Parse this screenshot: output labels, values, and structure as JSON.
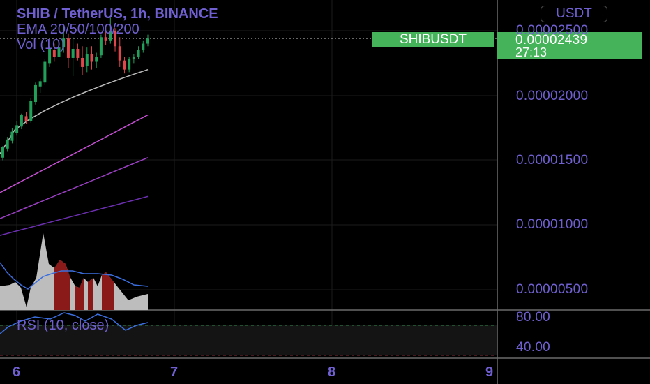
{
  "header": {
    "title": "SHIB / TetherUS, 1h, BINANCE",
    "ema_legend": "EMA 20/50/100/200",
    "vol_legend": "Vol (10)",
    "rsi_legend": "RSI (10, close)",
    "currency": "USDT"
  },
  "price_tag": {
    "symbol": "SHIBUSDT",
    "price": "0.00002439",
    "countdown": "27:13"
  },
  "axes": {
    "y_ticks": [
      "0.00002500",
      "0.00002000",
      "0.00001500",
      "0.00001000",
      "0.00000500"
    ],
    "rsi_ticks": [
      "80.00",
      "40.00"
    ],
    "x_ticks": [
      "6",
      "7",
      "8",
      "9"
    ]
  },
  "colors": {
    "up": "#22a05a",
    "down": "#e0464a",
    "accent": "#44b35a",
    "text": "#6f5fd0",
    "ema20": "#bdbdbd",
    "ema50": "#c64fd4",
    "ema100": "#9b3fc4",
    "ema200": "#6b2fb0",
    "vol_ma": "#3b6fe0"
  },
  "chart_data": {
    "type": "candlestick",
    "title": "SHIB / TetherUS, 1h, BINANCE",
    "x_ticks": [
      "6",
      "7",
      "8",
      "9"
    ],
    "ylim": [
      4.5e-06,
      2.66e-05
    ],
    "candles": [
      {
        "o": 1.52e-05,
        "h": 1.61e-05,
        "l": 1.5e-05,
        "c": 1.6e-05
      },
      {
        "o": 1.59e-05,
        "h": 1.68e-05,
        "l": 1.57e-05,
        "c": 1.66e-05
      },
      {
        "o": 1.65e-05,
        "h": 1.75e-05,
        "l": 1.63e-05,
        "c": 1.72e-05
      },
      {
        "o": 1.71e-05,
        "h": 1.8e-05,
        "l": 1.69e-05,
        "c": 1.77e-05
      },
      {
        "o": 1.76e-05,
        "h": 1.86e-05,
        "l": 1.74e-05,
        "c": 1.85e-05
      },
      {
        "o": 1.84e-05,
        "h": 1.87e-05,
        "l": 1.78e-05,
        "c": 1.8e-05
      },
      {
        "o": 1.8e-05,
        "h": 1.98e-05,
        "l": 1.79e-05,
        "c": 1.96e-05
      },
      {
        "o": 1.95e-05,
        "h": 2.1e-05,
        "l": 1.93e-05,
        "c": 2.08e-05
      },
      {
        "o": 2.07e-05,
        "h": 2.13e-05,
        "l": 2.02e-05,
        "c": 2.11e-05
      },
      {
        "o": 2.1e-05,
        "h": 2.28e-05,
        "l": 2.08e-05,
        "c": 2.26e-05
      },
      {
        "o": 2.25e-05,
        "h": 2.38e-05,
        "l": 2.22e-05,
        "c": 2.36e-05
      },
      {
        "o": 2.35e-05,
        "h": 2.4e-05,
        "l": 2.26e-05,
        "c": 2.3e-05
      },
      {
        "o": 2.3e-05,
        "h": 2.38e-05,
        "l": 2.28e-05,
        "c": 2.37e-05
      },
      {
        "o": 2.37e-05,
        "h": 2.53e-05,
        "l": 2.33e-05,
        "c": 2.44e-05
      },
      {
        "o": 2.44e-05,
        "h": 2.48e-05,
        "l": 2.21e-05,
        "c": 2.29e-05
      },
      {
        "o": 2.29e-05,
        "h": 2.45e-05,
        "l": 2.15e-05,
        "c": 2.36e-05
      },
      {
        "o": 2.36e-05,
        "h": 2.4e-05,
        "l": 2.27e-05,
        "c": 2.29e-05
      },
      {
        "o": 2.29e-05,
        "h": 2.38e-05,
        "l": 2.16e-05,
        "c": 2.22e-05
      },
      {
        "o": 2.23e-05,
        "h": 2.37e-05,
        "l": 2.18e-05,
        "c": 2.32e-05
      },
      {
        "o": 2.32e-05,
        "h": 2.38e-05,
        "l": 2.2e-05,
        "c": 2.26e-05
      },
      {
        "o": 2.26e-05,
        "h": 2.33e-05,
        "l": 2.21e-05,
        "c": 2.3e-05
      },
      {
        "o": 2.31e-05,
        "h": 2.47e-05,
        "l": 2.29e-05,
        "c": 2.45e-05
      },
      {
        "o": 2.45e-05,
        "h": 2.53e-05,
        "l": 2.39e-05,
        "c": 2.42e-05
      },
      {
        "o": 2.42e-05,
        "h": 2.6e-05,
        "l": 2.4e-05,
        "c": 2.5e-05
      },
      {
        "o": 2.5e-05,
        "h": 2.52e-05,
        "l": 2.34e-05,
        "c": 2.38e-05
      },
      {
        "o": 2.38e-05,
        "h": 2.45e-05,
        "l": 2.22e-05,
        "c": 2.27e-05
      },
      {
        "o": 2.27e-05,
        "h": 2.3e-05,
        "l": 2.17e-05,
        "c": 2.2e-05
      },
      {
        "o": 2.2e-05,
        "h": 2.3e-05,
        "l": 2.18e-05,
        "c": 2.28e-05
      },
      {
        "o": 2.28e-05,
        "h": 2.32e-05,
        "l": 2.25e-05,
        "c": 2.3e-05
      },
      {
        "o": 2.3e-05,
        "h": 2.38e-05,
        "l": 2.28e-05,
        "c": 2.35e-05
      },
      {
        "o": 2.35e-05,
        "h": 2.42e-05,
        "l": 2.33e-05,
        "c": 2.4e-05
      },
      {
        "o": 2.4e-05,
        "h": 2.47e-05,
        "l": 2.38e-05,
        "c": 2.439e-05
      }
    ],
    "ema": [
      {
        "name": "EMA 20",
        "start": 1.55e-05,
        "end": 2.2e-05
      },
      {
        "name": "EMA 50",
        "start": 1.25e-05,
        "end": 1.85e-05
      },
      {
        "name": "EMA 100",
        "start": 1.05e-05,
        "end": 1.52e-05
      },
      {
        "name": "EMA 200",
        "start": 9.2e-06,
        "end": 1.22e-05
      }
    ],
    "rsi_ticks": [
      80,
      40
    ]
  }
}
